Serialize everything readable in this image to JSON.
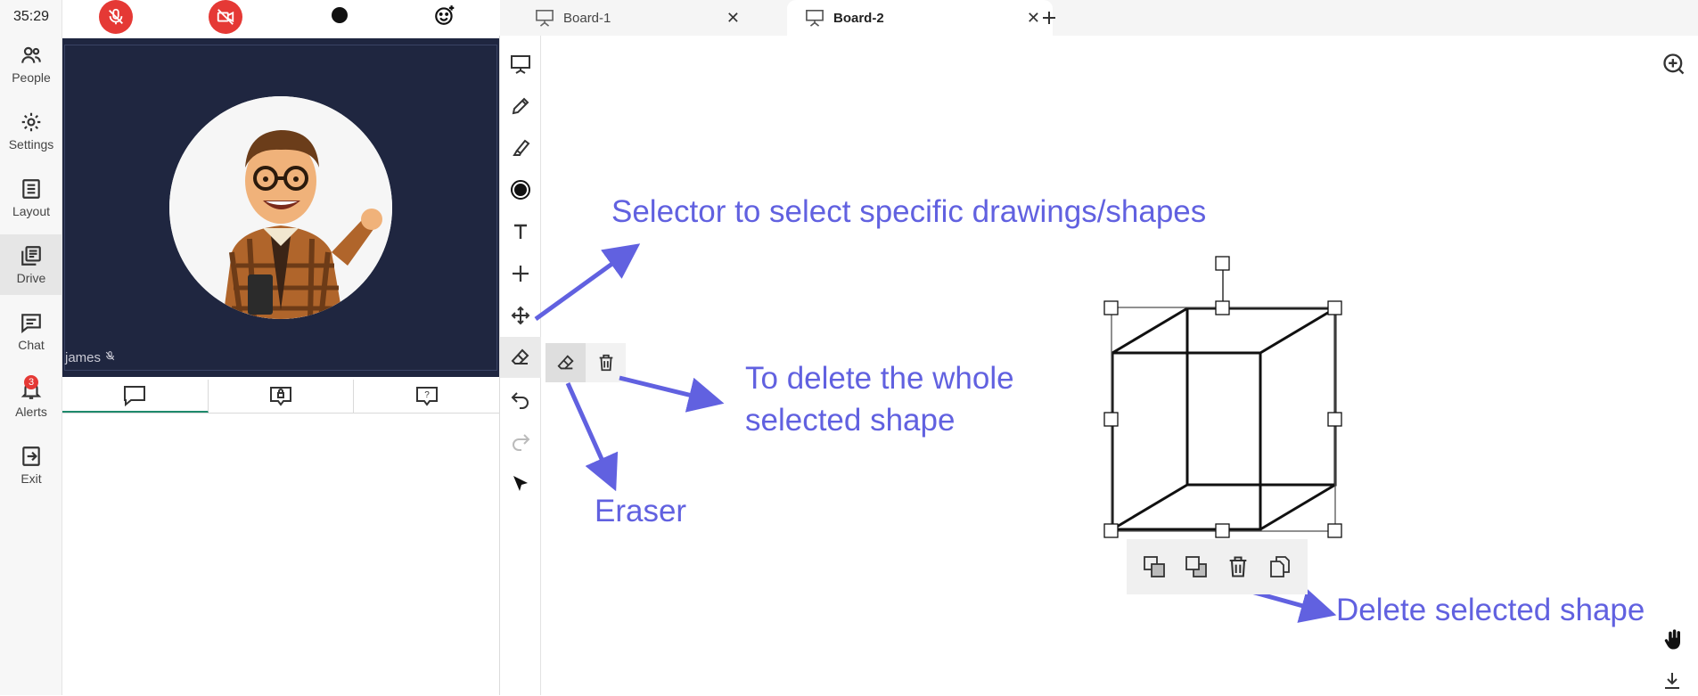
{
  "session": {
    "timer": "35:29"
  },
  "nav": {
    "items": [
      {
        "label": "People",
        "icon": "people-icon"
      },
      {
        "label": "Settings",
        "icon": "gear-icon"
      },
      {
        "label": "Layout",
        "icon": "layout-icon"
      },
      {
        "label": "Drive",
        "icon": "drive-icon"
      },
      {
        "label": "Chat",
        "icon": "chat-icon"
      },
      {
        "label": "Alerts",
        "icon": "bell-icon",
        "badge": "3"
      },
      {
        "label": "Exit",
        "icon": "exit-icon"
      }
    ]
  },
  "media_controls": [
    "mic-muted-icon",
    "camera-off-icon",
    "record-dot-icon",
    "emoji-add-icon"
  ],
  "video": {
    "participant_name": "james"
  },
  "chat_tabs": [
    "public-chat-icon",
    "private-chat-icon",
    "question-icon"
  ],
  "board_tabs": [
    {
      "label": "Board-1",
      "active": false
    },
    {
      "label": "Board-2",
      "active": true
    }
  ],
  "add_tab_icon": "plus-icon",
  "tools": [
    "presentation-icon",
    "pencil-icon",
    "highlighter-icon",
    "color-dot-icon",
    "text-icon",
    "plus-icon",
    "move-selector-icon",
    "eraser-icon",
    "undo-icon",
    "redo-icon",
    "pointer-icon"
  ],
  "eraser_popup": [
    "eraser-icon",
    "trash-icon"
  ],
  "shape_menu": [
    "bring-forward-icon",
    "send-backward-icon",
    "trash-icon",
    "duplicate-icon"
  ],
  "annotations": {
    "selector": "Selector to select specific drawings/shapes",
    "delete_whole_line1": "To delete the whole",
    "delete_whole_line2": "selected shape",
    "eraser": "Eraser",
    "delete_selected": "Delete selected shape"
  },
  "colors": {
    "accent": "#6161e0",
    "danger": "#e53935",
    "video_bg": "#1f2640",
    "tab_active_underline": "#1e8a6b"
  }
}
